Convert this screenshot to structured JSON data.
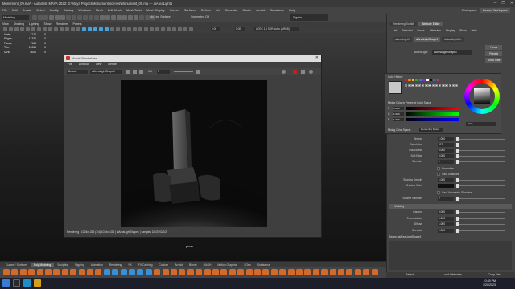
{
  "window": {
    "title": "Monument_09.ma* - Autodesk MAYA 2023: E:\\Maya Project\\Monument\\scenes\\Monument_09.ma --- aiAreaLight1",
    "controls": [
      "─",
      "❐",
      "✕"
    ]
  },
  "menubar": {
    "items": [
      "File",
      "Edit",
      "Create",
      "Select",
      "Modify",
      "Display",
      "Windows",
      "Mesh",
      "Edit Mesh",
      "Mesh Tools",
      "Mesh Display",
      "Curves",
      "Surfaces",
      "Deform",
      "UV",
      "Generate",
      "Cache",
      "Arnold",
      "Substance",
      "Help"
    ],
    "workspace_label": "Workspace:",
    "workspace_value": "Custom Workspace"
  },
  "statusline": {
    "mode": "Modeling",
    "no_live_surface": "No Live Surface",
    "symmetry": "Symmetry: Off",
    "sign_in": "Sign In"
  },
  "viewport": {
    "menu": [
      "View",
      "Shading",
      "Lighting",
      "Show",
      "Renderer",
      "Panels"
    ],
    "toolbar": {
      "value_1": "0.00",
      "value_2": "1.00",
      "color_space": "ACES 1.0 SDR-video (sRGB)"
    },
    "hud": [
      {
        "label": "Verts:",
        "value": "7176",
        "z": "0"
      },
      {
        "label": "Edges:",
        "value": "14336",
        "z": "0"
      },
      {
        "label": "Faces:",
        "value": "7168",
        "z": "0"
      },
      {
        "label": "Tris:",
        "value": "14336",
        "z": "0"
      },
      {
        "label": "UVs:",
        "value": "8000",
        "z": "0"
      }
    ],
    "camera": "persp"
  },
  "render_view": {
    "title": "Arnold RenderView",
    "menu": [
      "File",
      "Window",
      "View",
      "Render"
    ],
    "dropdown_1": "Beauty",
    "dropdown_2": "aiAreaLightShape1",
    "ratio": "1:1",
    "exposure_value": "0",
    "status": "Rendering | 1024x1024 (1/4) 1024x1024 | aiAreaLightShape1 | samples 3/2/2/2/2/2/2"
  },
  "shelf": {
    "tabs": [
      "Curves / Surfaces",
      "Poly Modeling",
      "Sculpting",
      "Rigging",
      "Animation",
      "Rendering",
      "FX",
      "FX Caching",
      "Custom",
      "Arnold",
      "Bifrost",
      "MASH",
      "Motion Graphics",
      "XGen",
      "Substance"
    ],
    "active_tab": "Poly Modeling",
    "icon_colors": [
      "#d46a2a",
      "#d46a2a",
      "#d46a2a",
      "#d46a2a",
      "#d46a2a",
      "#d46a2a",
      "#d46a2a",
      "#d46a2a",
      "#d46a2a",
      "#d46a2a",
      "#d46a2a",
      "#d46a2a",
      "#3a8fd6",
      "#3a8fd6",
      "#3a8fd6",
      "#3a8fd6",
      "#3a8fd6",
      "#3a8fd6",
      "#d46a2a",
      "#d46a2a",
      "#d46a2a",
      "#d46a2a",
      "#d46a2a",
      "#d46a2a",
      "#d46a2a",
      "#d46a2a",
      "#d46a2a",
      "#d46a2a",
      "#d46a2a",
      "#d46a2a",
      "#d46a2a",
      "#d46a2a",
      "#d46a2a",
      "#d46a2a",
      "#d46a2a",
      "#d46a2a",
      "#d46a2a",
      "#d46a2a",
      "#d46a2a",
      "#d46a2a",
      "#d46a2a",
      "#d46a2a",
      "#d46a2a",
      "#d46a2a",
      "#d46a2a"
    ]
  },
  "right_panel": {
    "tabs": [
      "Rendering Toolkit",
      "Attribute Editor"
    ],
    "active_tab": "Attribute Editor",
    "ae_menu": [
      "List",
      "Selected",
      "Focus",
      "Attributes",
      "Display",
      "Show",
      "Help"
    ],
    "node_tabs": [
      "aiAreaLight1",
      "aiAreaLightShape1",
      "defaultLightSet"
    ],
    "active_node_tab": "aiAreaLightShape1",
    "node_label": "aiAreaLight:",
    "node_value": "aiAreaLightShape1",
    "buttons": [
      "Focus",
      "Presets",
      "Show  Hide"
    ]
  },
  "color_popup": {
    "title": "Color History",
    "mixing_label": "Mixing Color in Preferred Color Space",
    "rows": [
      {
        "label": "R",
        "value": "1.000"
      },
      {
        "label": "G",
        "value": "1.000"
      },
      {
        "label": "B",
        "value": "1.000"
      }
    ],
    "mode": "RGB",
    "space_label": "Mixing Color Space:",
    "space_value": "Rendering Space",
    "chips": [
      "#cc2222",
      "#e08020",
      "#e0c020",
      "#30a030",
      "#2080d0",
      "#8030c0",
      "#ffffff",
      "#111111",
      "#3366cc",
      "#cc3366"
    ]
  },
  "attributes": {
    "rows1": [
      {
        "label": "Spread",
        "value": "1.000"
      },
      {
        "label": "Resolution",
        "value": "512"
      },
      {
        "label": "Roundness",
        "value": "0.000"
      },
      {
        "label": "Soft Edge",
        "value": "0.000"
      },
      {
        "label": "Samples",
        "value": "1"
      }
    ],
    "normalize": "Normalize",
    "cast_shadows": "Cast Shadows",
    "rows2": [
      {
        "label": "Shadow Density",
        "value": "1.000"
      },
      {
        "label": "Shadow Color",
        "value": ""
      }
    ],
    "cast_volumetric": "Cast Volumetric Shadows",
    "rows3": [
      {
        "label": "Volume Samples",
        "value": "2"
      }
    ],
    "visibility_header": "Visibility",
    "rows4": [
      {
        "label": "Camera",
        "value": "0.000"
      },
      {
        "label": "Transmission",
        "value": "0.000"
      },
      {
        "label": "Diffuse",
        "value": "1.000"
      },
      {
        "label": "Specular",
        "value": "1.000"
      }
    ],
    "notes_label": "Notes: aiAreaLightShape1"
  },
  "bottom_buttons": [
    "Select",
    "Load Attributes",
    "Copy Tab"
  ],
  "taskbar": {
    "time": "10:45 PM",
    "date": "1/20/2023"
  }
}
